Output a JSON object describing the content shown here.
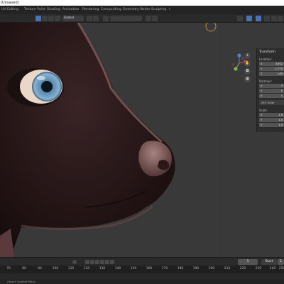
{
  "app": {
    "title": "(Unsaved)"
  },
  "workspace_tabs": [
    "UV Editing",
    "Texture Paint",
    "Shading",
    "Animation",
    "Rendering",
    "Compositing",
    "Geometry Nodes",
    "Sculpting",
    "+"
  ],
  "header": {
    "transform_orientation": "Global"
  },
  "sidebar": {
    "title": "Transform",
    "location_label": "Location:",
    "location": [
      {
        "axis": "X",
        "value": "3.652"
      },
      {
        "axis": "Y",
        "value": "-1.775"
      },
      {
        "axis": "Z",
        "value": "1.69"
      }
    ],
    "rotation_label": "Rotation:",
    "rotation": [
      {
        "axis": "X",
        "value": "9"
      },
      {
        "axis": "Y",
        "value": "0"
      },
      {
        "axis": "Z",
        "value": "1"
      }
    ],
    "rotation_mode": "XYZ Euler",
    "scale_label": "Scale:",
    "scale": [
      {
        "axis": "X",
        "value": "1.0"
      },
      {
        "axis": "Y",
        "value": "1.0"
      },
      {
        "axis": "Z",
        "value": "1.0"
      }
    ]
  },
  "timeline": {
    "current_frame": "1",
    "start_label": "Start",
    "start_value": "1",
    "ticks": [
      "70",
      "80",
      "90",
      "100",
      "110",
      "120",
      "130",
      "140",
      "150",
      "160",
      "170",
      "180",
      "190",
      "200",
      "210",
      "220",
      "230",
      "240",
      "250"
    ]
  },
  "statusbar": {
    "text": "Object Context Menu"
  },
  "icons": {
    "navigation": [
      "zoom-icon",
      "hand-pan-icon",
      "camera-icon",
      "grid-icon"
    ]
  }
}
